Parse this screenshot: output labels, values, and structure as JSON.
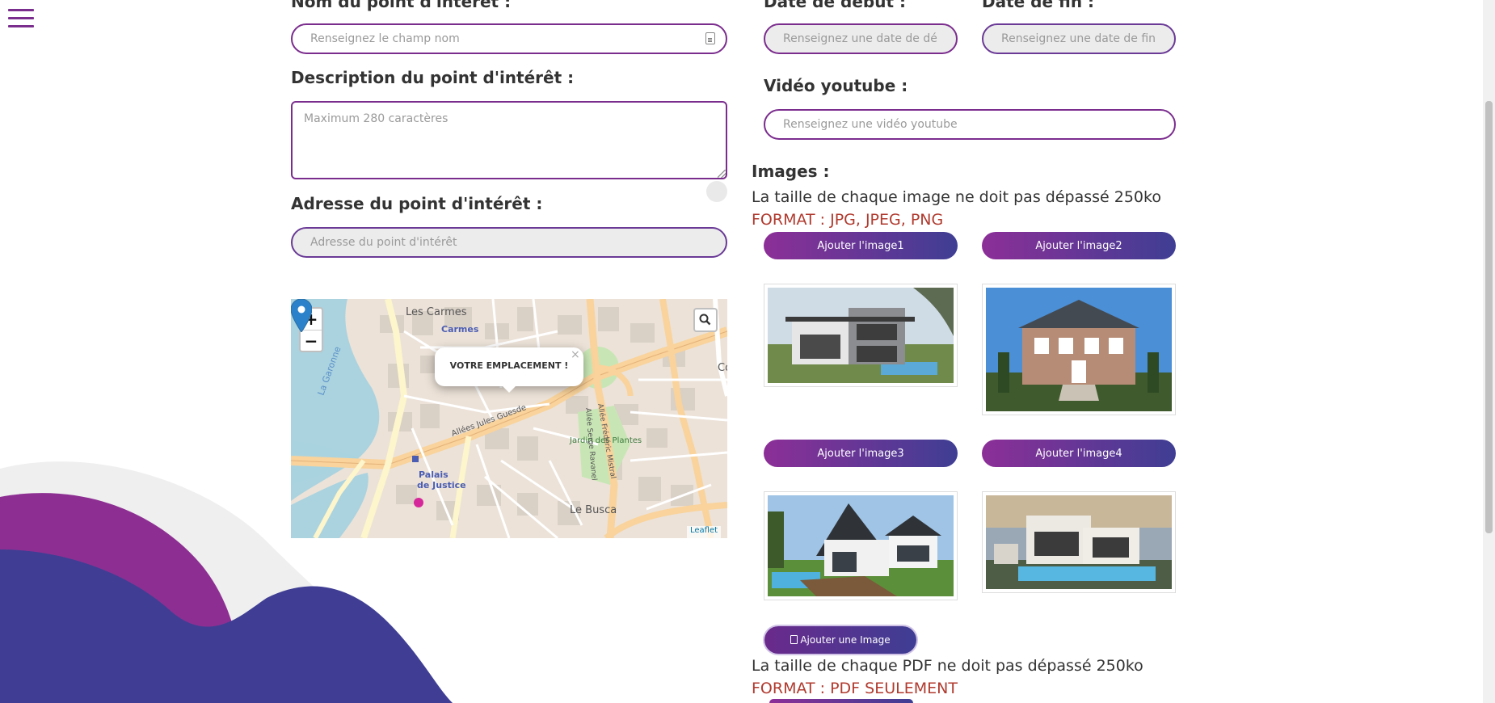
{
  "menu": {
    "icon": "hamburger-menu-icon"
  },
  "form": {
    "name_label": "Nom du point d'intérêt :",
    "name_placeholder": "Renseignez le champ nom",
    "description_label": "Description du point d'intérêt :",
    "description_placeholder": "Maximum 280 caractères",
    "address_label": "Adresse du point d'intérêt :",
    "address_placeholder": "Adresse du point d'intérêt",
    "start_date_label": "Date de début :",
    "start_date_placeholder": "Renseignez une date de début",
    "end_date_label": "Date de fin :",
    "end_date_placeholder": "Renseignez une date de fin",
    "youtube_label": "Vidéo youtube :",
    "youtube_placeholder": "Renseignez une vidéo youtube"
  },
  "map": {
    "zoom_in": "+",
    "zoom_out": "−",
    "popup_text": "VOTRE EMPLACEMENT !",
    "popup_close": "×",
    "attribution": "Leaflet",
    "places": {
      "carmes_district": "Les Carmes",
      "carmes": "Carmes",
      "garonne": "La Garonne",
      "allees": "Allées Jules Guesde",
      "jardin": "Jardin des Plantes",
      "palais": "Palais",
      "de_justice": "de Justice",
      "le_busca": "Le Busca",
      "frederic": "Allée Frédéric Mistral",
      "serge": "Allée Serge Ravanel",
      "co": "Co"
    }
  },
  "images": {
    "label": "Images :",
    "size_info": "La taille de chaque image ne doit pas dépassé 250ko",
    "format_info": "FORMAT : JPG, JPEG, PNG",
    "buttons": [
      "Ajouter l'image1",
      "Ajouter l'image2",
      "Ajouter l'image3",
      "Ajouter l'image4"
    ],
    "add_image": "Ajouter une Image"
  },
  "pdf": {
    "size_info": "La taille de chaque PDF ne doit pas dépassé 250ko",
    "format_info": "FORMAT : PDF SEULEMENT"
  },
  "colors": {
    "accent_purple": "#7b2d8e",
    "accent_indigo": "#3f3e94",
    "format_red": "#b03a2e"
  }
}
